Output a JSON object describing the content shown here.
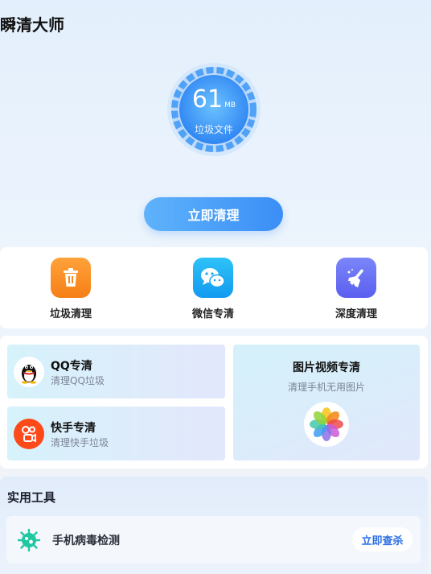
{
  "app": {
    "title": "瞬清大师"
  },
  "gauge": {
    "value": "61",
    "unit": "MB",
    "label": "垃圾文件"
  },
  "clean_button": "立即清理",
  "quick_actions": [
    {
      "label": "垃圾清理",
      "icon": "trash-icon",
      "color": "#fb8c1f"
    },
    {
      "label": "微信专清",
      "icon": "wechat-icon",
      "color": "#1aa8f0"
    },
    {
      "label": "深度清理",
      "icon": "broom-icon",
      "color": "#6a6cf2"
    }
  ],
  "special": {
    "qq": {
      "title": "QQ专清",
      "subtitle": "清理QQ垃圾",
      "icon": "qq-penguin-icon"
    },
    "kuaishou": {
      "title": "快手专清",
      "subtitle": "清理快手垃圾",
      "icon": "kuaishou-icon",
      "color": "#fe4a1a"
    },
    "photos": {
      "title": "图片视频专清",
      "subtitle": "清理手机无用图片",
      "icon": "photos-flower-icon"
    }
  },
  "tools": {
    "title": "实用工具",
    "items": [
      {
        "label": "手机病毒检测",
        "button": "立即查杀",
        "icon": "virus-scan-icon",
        "color": "#21c7a0"
      }
    ]
  }
}
